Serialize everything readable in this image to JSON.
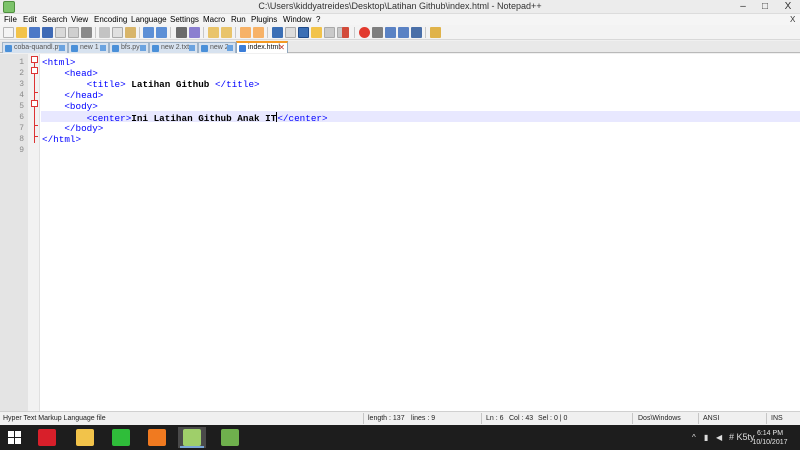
{
  "window": {
    "title": "C:\\Users\\kiddyatreides\\Desktop\\Latihan Github\\index.html - Notepad++",
    "minimize": "–",
    "maximize": "□",
    "close": "X"
  },
  "menu": {
    "items": [
      "File",
      "Edit",
      "Search",
      "View",
      "Encoding",
      "Language",
      "Settings",
      "Macro",
      "Run",
      "Plugins",
      "Window",
      "?"
    ],
    "close_x": "X"
  },
  "tabs": [
    {
      "label": "coba-quandl.py",
      "active": false
    },
    {
      "label": "new 1",
      "active": false
    },
    {
      "label": "bfs.py",
      "active": false
    },
    {
      "label": "new 2.txt",
      "active": false
    },
    {
      "label": "new 2",
      "active": false
    },
    {
      "label": "index.html",
      "active": true
    }
  ],
  "editor": {
    "line_numbers": [
      "1",
      "2",
      "3",
      "4",
      "5",
      "6",
      "7",
      "8",
      "9"
    ],
    "lines": [
      {
        "indent": "",
        "parts": [
          {
            "t": "tag",
            "v": "<html>"
          }
        ]
      },
      {
        "indent": "    ",
        "parts": [
          {
            "t": "tag",
            "v": "<head>"
          }
        ]
      },
      {
        "indent": "        ",
        "parts": [
          {
            "t": "tag",
            "v": "<title>"
          },
          {
            "t": "txt",
            "v": " Latihan Github "
          },
          {
            "t": "tag",
            "v": "</title>"
          }
        ]
      },
      {
        "indent": "    ",
        "parts": [
          {
            "t": "tag",
            "v": "</head>"
          }
        ]
      },
      {
        "indent": "    ",
        "parts": [
          {
            "t": "tag",
            "v": "<body>"
          }
        ]
      },
      {
        "indent": "        ",
        "parts": [
          {
            "t": "tag",
            "v": "<center>"
          },
          {
            "t": "txt",
            "v": "Ini Latihan Github Anak IT"
          },
          {
            "t": "caret",
            "v": ""
          },
          {
            "t": "tag",
            "v": "</center>"
          }
        ]
      },
      {
        "indent": "    ",
        "parts": [
          {
            "t": "tag",
            "v": "</body>"
          }
        ]
      },
      {
        "indent": "",
        "parts": [
          {
            "t": "tag",
            "v": "</html>"
          }
        ]
      },
      {
        "indent": "",
        "parts": []
      }
    ]
  },
  "status": {
    "file_type": "Hyper Text Markup Language file",
    "length": "length : 137",
    "lines": "lines : 9",
    "ln": "Ln : 6",
    "col": "Col : 43",
    "sel": "Sel : 0 | 0",
    "eol": "Dos\\Windows",
    "encoding": "ANSI",
    "mode": "INS"
  },
  "taskbar": {
    "apps": [
      {
        "name": "opera",
        "color": "#d81f2a"
      },
      {
        "name": "file-explorer",
        "color": "#f2c34a"
      },
      {
        "name": "line",
        "color": "#2fbd3a"
      },
      {
        "name": "xampp",
        "color": "#f07a20"
      },
      {
        "name": "notepad-plus-plus",
        "color": "#9fcf6a"
      },
      {
        "name": "git-gui",
        "color": "#6fb04d"
      }
    ],
    "clock_time": "6:14 PM",
    "clock_date": "10/10/2017",
    "tray_overlay": "# K5ty"
  },
  "colors": {
    "tag": "#0000ff",
    "active_tab_accent": "#f59a23",
    "current_line": "#e8e8ff",
    "taskbar": "#1d1d1d"
  }
}
